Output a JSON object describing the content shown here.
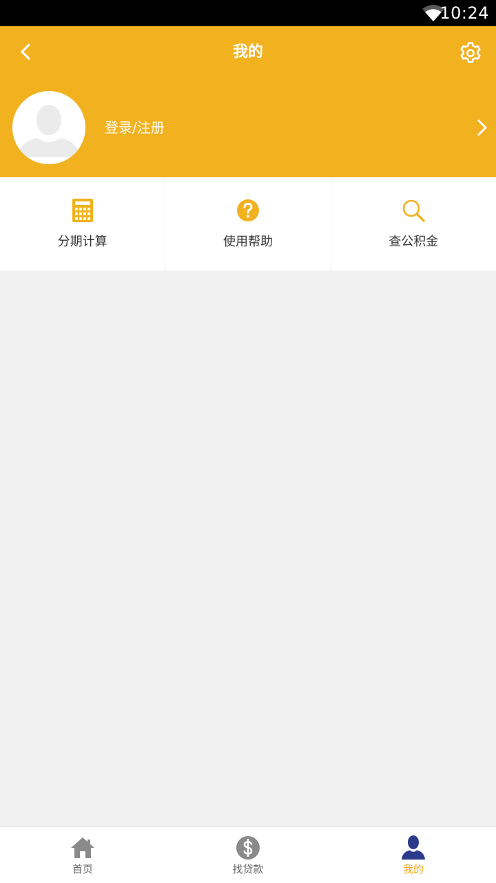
{
  "status_bar": {
    "time": "10:24"
  },
  "header": {
    "title": "我的",
    "login_label": "登录/注册"
  },
  "tools": [
    {
      "label": "分期计算",
      "icon": "calculator-icon"
    },
    {
      "label": "使用帮助",
      "icon": "question-circle-icon"
    },
    {
      "label": "查公积金",
      "icon": "search-icon"
    }
  ],
  "bottom_nav": [
    {
      "label": "首页",
      "icon": "home-icon",
      "active": false
    },
    {
      "label": "找贷款",
      "icon": "dollar-circle-icon",
      "active": false
    },
    {
      "label": "我的",
      "icon": "user-icon",
      "active": true
    }
  ],
  "colors": {
    "accent": "#f2b11f",
    "active_tab": "#f2a818",
    "active_user_icon": "#2c3a8c",
    "inactive_icon": "#8a8a8a",
    "background": "#f0f0f0"
  }
}
